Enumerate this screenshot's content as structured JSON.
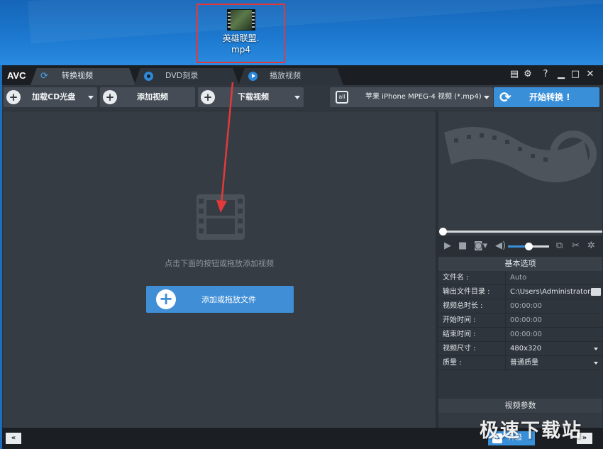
{
  "desktop": {
    "file_name_line1": "英雄联盟.",
    "file_name_line2": "mp4"
  },
  "app": {
    "logo": "AVC"
  },
  "tabs": [
    {
      "label": "转换视频",
      "icon": "refresh-icon",
      "active": true
    },
    {
      "label": "DVD刻录",
      "icon": "disc-icon",
      "active": false
    },
    {
      "label": "播放视频",
      "icon": "play-icon",
      "active": false
    }
  ],
  "window_controls": {
    "help": "?"
  },
  "toolbar": {
    "load_cd": "加载CD光盘",
    "add_video": "添加视频",
    "download_video": "下载视频",
    "profile": "苹果 iPhone MPEG-4 视频 (*.mp4)",
    "profile_icon_text": "all",
    "convert": "开始转换 !"
  },
  "main": {
    "hint": "点击下面的按钮或拖放添加视频",
    "add_file": "添加或拖放文件"
  },
  "player": {
    "seek_position": 0,
    "volume": 0.5
  },
  "panel": {
    "header": "基本选项",
    "rows": [
      {
        "label": "文件名 :",
        "value": "Auto"
      },
      {
        "label": "输出文件目录 :",
        "value": "C:\\Users\\Administrator..."
      },
      {
        "label": "视频总时长 :",
        "value": "00:00:00"
      },
      {
        "label": "开始时间 :",
        "value": "00:00:00"
      },
      {
        "label": "结束时间 :",
        "value": "00:00:00"
      },
      {
        "label": "视频尺寸 :",
        "value": "480x320"
      },
      {
        "label": "质量 :",
        "value": "普通质量"
      }
    ],
    "footer": "视频参数"
  },
  "statusbar": {
    "prev": "«",
    "next": "»",
    "upgrade": "升级"
  },
  "watermark": "极速下载站",
  "colors": {
    "accent": "#3a8fd9",
    "annotation": "#e23a3a"
  }
}
